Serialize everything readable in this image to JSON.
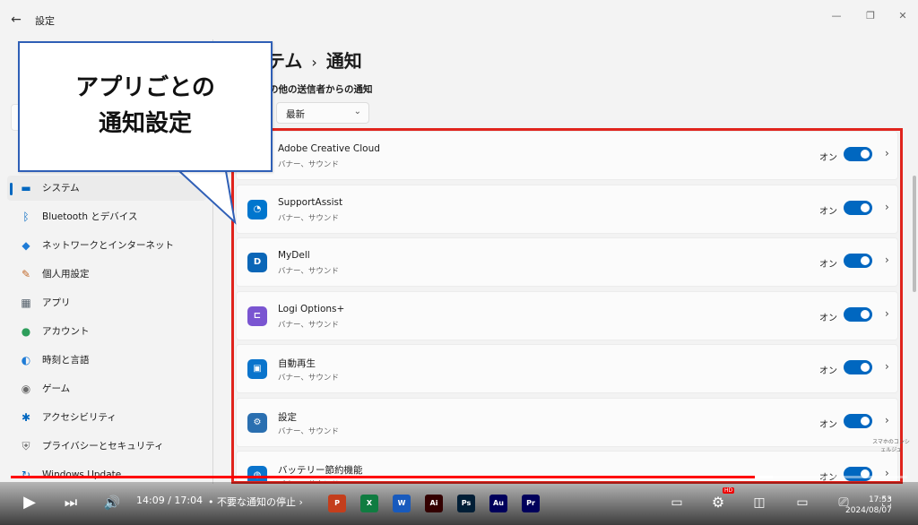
{
  "window": {
    "title": "設定",
    "back_glyph": "←",
    "min_glyph": "—",
    "max_glyph": "❐",
    "close_glyph": "✕"
  },
  "sidebar": {
    "items": [
      {
        "label": "システム",
        "icon": "system-icon",
        "glyph": "▬",
        "color": "#0067c0",
        "active": true
      },
      {
        "label": "Bluetooth とデバイス",
        "icon": "bluetooth-icon",
        "glyph": "ᛒ",
        "color": "#0067c0"
      },
      {
        "label": "ネットワークとインターネット",
        "icon": "wifi-icon",
        "glyph": "◆",
        "color": "#1e7bd6"
      },
      {
        "label": "個人用設定",
        "icon": "brush-icon",
        "glyph": "✎",
        "color": "#c26a2b"
      },
      {
        "label": "アプリ",
        "icon": "apps-icon",
        "glyph": "▦",
        "color": "#55606b"
      },
      {
        "label": "アカウント",
        "icon": "account-icon",
        "glyph": "●",
        "color": "#2e9e5b"
      },
      {
        "label": "時刻と言語",
        "icon": "globe-clock-icon",
        "glyph": "◐",
        "color": "#1e7bd6"
      },
      {
        "label": "ゲーム",
        "icon": "gamepad-icon",
        "glyph": "◉",
        "color": "#6b6b6b"
      },
      {
        "label": "アクセシビリティ",
        "icon": "accessibility-icon",
        "glyph": "✱",
        "color": "#0067c0"
      },
      {
        "label": "プライバシーとセキュリティ",
        "icon": "shield-icon",
        "glyph": "⛨",
        "color": "#6b6b6b"
      },
      {
        "label": "Windows Update",
        "icon": "update-icon",
        "glyph": "↻",
        "color": "#0067c0"
      }
    ]
  },
  "main": {
    "title_prefix": "テム",
    "title_sep": "›",
    "title": "通知",
    "section_label": "の他の送信者からの通知",
    "sort": {
      "value": "最新",
      "chevron": "⌄"
    },
    "apps": [
      {
        "name": "Adobe Creative Cloud",
        "sub": "バナー、サウンド",
        "toggle": "オン",
        "on": true,
        "icon": "creative-cloud-icon",
        "color": "#da1f26",
        "glyph": "Cc"
      },
      {
        "name": "SupportAssist",
        "sub": "バナー、サウンド",
        "toggle": "オン",
        "on": true,
        "icon": "supportassist-icon",
        "color": "#0076ce",
        "glyph": "◔"
      },
      {
        "name": "MyDell",
        "sub": "バナー、サウンド",
        "toggle": "オン",
        "on": true,
        "icon": "dell-icon",
        "color": "#0a66b7",
        "glyph": "D"
      },
      {
        "name": "Logi Options+",
        "sub": "バナー、サウンド",
        "toggle": "オン",
        "on": true,
        "icon": "logi-icon",
        "color": "#7a55d1",
        "glyph": "⊏"
      },
      {
        "name": "自動再生",
        "sub": "バナー、サウンド",
        "toggle": "オン",
        "on": true,
        "icon": "autoplay-icon",
        "color": "#0a74cc",
        "glyph": "▣"
      },
      {
        "name": "設定",
        "sub": "バナー、サウンド",
        "toggle": "オン",
        "on": true,
        "icon": "settings-gear-icon",
        "color": "#2a6fb0",
        "glyph": "⚙"
      },
      {
        "name": "バッテリー節約機能",
        "sub": "バナー、サウンド",
        "toggle": "オン",
        "on": true,
        "icon": "battery-saver-icon",
        "color": "#0a74cc",
        "glyph": "◍"
      }
    ],
    "row_chevron": "›"
  },
  "callout": {
    "line1": "アプリごとの",
    "line2": "通知設定"
  },
  "player": {
    "time": "14:09 / 17:04",
    "chapter": "• 不要な通知の停止",
    "chapter_chevron": "›",
    "progress": 0.83,
    "buffered": 0.85,
    "hd": "HD",
    "play_glyph": "▶",
    "next_glyph": "⏭",
    "volume_glyph": "🔊"
  },
  "taskbar": {
    "date": "2024/08/07",
    "time": "17:53",
    "apps": [
      {
        "icon": "powerpoint-icon",
        "color": "#c43e1c",
        "glyph": "P"
      },
      {
        "icon": "excel-icon",
        "color": "#107c41",
        "glyph": "X"
      },
      {
        "icon": "word-icon",
        "color": "#185abd",
        "glyph": "W"
      },
      {
        "icon": "illustrator-icon",
        "color": "#330000",
        "glyph": "Ai"
      },
      {
        "icon": "photoshop-icon",
        "color": "#001e36",
        "glyph": "Ps"
      },
      {
        "icon": "audition-icon",
        "color": "#00005b",
        "glyph": "Au"
      },
      {
        "icon": "premiere-icon",
        "color": "#00005b",
        "glyph": "Pr"
      }
    ]
  },
  "watermark": "スマホのコンシェルジュ"
}
